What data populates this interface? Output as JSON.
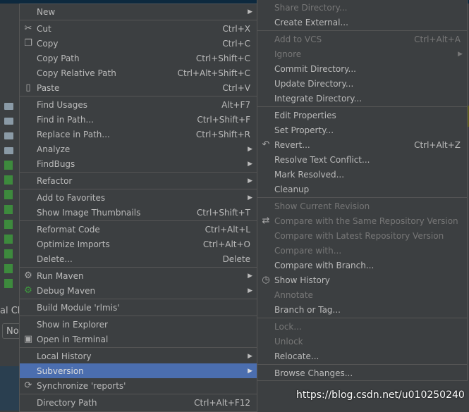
{
  "main_menu": [
    {
      "label": "New",
      "arrow": true
    },
    {
      "sep": true
    },
    {
      "label": "Cut",
      "shortcut": "Ctrl+X",
      "icon": "scissors-icon",
      "glyph": "✂"
    },
    {
      "label": "Copy",
      "shortcut": "Ctrl+C",
      "icon": "copy-icon",
      "glyph": "❐"
    },
    {
      "label": "Copy Path",
      "shortcut": "Ctrl+Shift+C"
    },
    {
      "label": "Copy Relative Path",
      "shortcut": "Ctrl+Alt+Shift+C"
    },
    {
      "label": "Paste",
      "shortcut": "Ctrl+V",
      "icon": "clipboard-icon",
      "glyph": "▯"
    },
    {
      "sep": true
    },
    {
      "label": "Find Usages",
      "shortcut": "Alt+F7"
    },
    {
      "label": "Find in Path...",
      "shortcut": "Ctrl+Shift+F"
    },
    {
      "label": "Replace in Path...",
      "shortcut": "Ctrl+Shift+R"
    },
    {
      "label": "Analyze",
      "arrow": true
    },
    {
      "label": "FindBugs",
      "arrow": true
    },
    {
      "sep": true
    },
    {
      "label": "Refactor",
      "arrow": true
    },
    {
      "sep": true
    },
    {
      "label": "Add to Favorites",
      "arrow": true
    },
    {
      "label": "Show Image Thumbnails",
      "shortcut": "Ctrl+Shift+T"
    },
    {
      "sep": true
    },
    {
      "label": "Reformat Code",
      "shortcut": "Ctrl+Alt+L"
    },
    {
      "label": "Optimize Imports",
      "shortcut": "Ctrl+Alt+O"
    },
    {
      "label": "Delete...",
      "shortcut": "Delete"
    },
    {
      "sep": true
    },
    {
      "label": "Run Maven",
      "arrow": true,
      "icon": "gear-icon",
      "glyph": "⚙"
    },
    {
      "label": "Debug Maven",
      "arrow": true,
      "icon": "debug-gear-icon",
      "glyph": "⚙",
      "color": "#3d9a3d"
    },
    {
      "sep": true
    },
    {
      "label": "Build Module 'rlmis'"
    },
    {
      "sep": true
    },
    {
      "label": "Show in Explorer"
    },
    {
      "label": "Open in Terminal",
      "icon": "terminal-icon",
      "glyph": "▣"
    },
    {
      "sep": true
    },
    {
      "label": "Local History",
      "arrow": true
    },
    {
      "label": "Subversion",
      "arrow": true,
      "selected": true
    },
    {
      "label": "Synchronize 'reports'",
      "icon": "sync-icon",
      "glyph": "⟳"
    },
    {
      "sep": true
    },
    {
      "label": "Directory Path",
      "shortcut": "Ctrl+Alt+F12"
    }
  ],
  "subversion_menu": [
    {
      "label": "Share Directory...",
      "disabled": true
    },
    {
      "label": "Create External..."
    },
    {
      "sep": true
    },
    {
      "label": "Add to VCS",
      "shortcut": "Ctrl+Alt+A",
      "disabled": true
    },
    {
      "label": "Ignore",
      "arrow": true,
      "disabled": true
    },
    {
      "label": "Commit Directory..."
    },
    {
      "label": "Update Directory..."
    },
    {
      "label": "Integrate Directory..."
    },
    {
      "sep": true
    },
    {
      "label": "Edit Properties"
    },
    {
      "label": "Set Property..."
    },
    {
      "label": "Revert...",
      "shortcut": "Ctrl+Alt+Z",
      "icon": "revert-icon",
      "glyph": "↶"
    },
    {
      "label": "Resolve Text Conflict..."
    },
    {
      "label": "Mark Resolved..."
    },
    {
      "label": "Cleanup"
    },
    {
      "sep": true
    },
    {
      "label": "Show Current Revision",
      "disabled": true
    },
    {
      "label": "Compare with the Same Repository Version",
      "disabled": true,
      "icon": "compare-icon",
      "glyph": "⇄"
    },
    {
      "label": "Compare with Latest Repository Version",
      "disabled": true
    },
    {
      "label": "Compare with...",
      "disabled": true
    },
    {
      "label": "Compare with Branch..."
    },
    {
      "label": "Show History",
      "icon": "history-icon",
      "glyph": "◷"
    },
    {
      "label": "Annotate",
      "disabled": true
    },
    {
      "label": "Branch or Tag..."
    },
    {
      "sep": true
    },
    {
      "label": "Lock...",
      "disabled": true
    },
    {
      "label": "Unlock",
      "disabled": true
    },
    {
      "label": "Relocate..."
    },
    {
      "sep": true
    },
    {
      "label": "Browse Changes..."
    }
  ],
  "background": {
    "panel_text_1": "al Ch",
    "panel_text_2": "No"
  },
  "watermark": "https://blog.csdn.net/u010250240",
  "colors": {
    "menu_bg": "#3c3f41",
    "text": "#bbbbbb",
    "disabled": "#777777",
    "highlight": "#4b6eaf"
  }
}
